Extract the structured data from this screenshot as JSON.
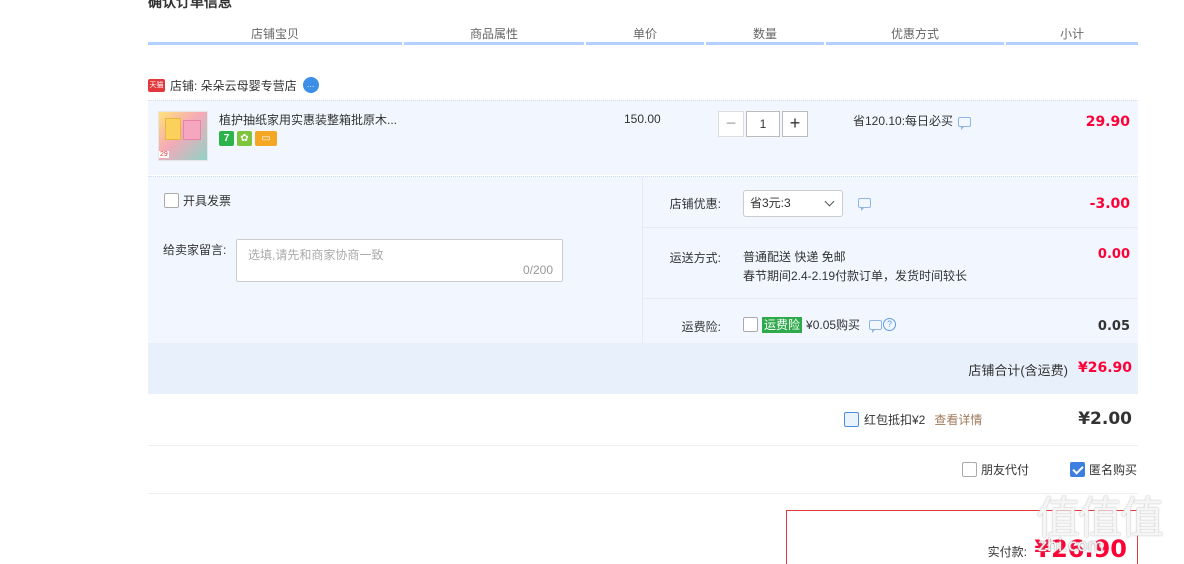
{
  "section_title": "确认订单信息",
  "columns": [
    "店铺宝贝",
    "商品属性",
    "单价",
    "数量",
    "优惠方式",
    "小计"
  ],
  "shop": {
    "logo_text": "天猫",
    "label": "店铺: 朵朵云母婴专营店"
  },
  "item": {
    "title": "植护抽纸家用实惠装整箱批原木...",
    "thumb_price": "29",
    "unit_price": "150.00",
    "quantity": "1",
    "minus_label": "−",
    "plus_label": "+",
    "discount": "省120.10:每日必买",
    "subtotal": "29.90",
    "icon_seven": "7"
  },
  "options": {
    "invoice_label": "开具发票",
    "message_label": "给卖家留言:",
    "message_placeholder": "选填,请先和商家协商一致",
    "message_count": "0/200",
    "shop_discount_label": "店铺优惠:",
    "shop_discount_value": "省3元:3",
    "shop_discount_amount": "-3.00",
    "shipping_label": "运送方式:",
    "shipping_line1": "普通配送 快递 免邮",
    "shipping_line2": "春节期间2.4-2.19付款订单，发货时间较长",
    "shipping_amount": "0.00",
    "insurance_label": "运费险:",
    "insurance_tag": "运费险",
    "insurance_text": "¥0.05购买",
    "insurance_amount": "0.05"
  },
  "shop_total": {
    "label": "店铺合计(含运费)",
    "amount": "¥26.90"
  },
  "red_packet": {
    "label": "红包抵扣¥2",
    "detail": "查看详情",
    "amount": "¥2.00"
  },
  "buy_options": {
    "friend_pay": "朋友代付",
    "anonymous": "匿名购买"
  },
  "payment": {
    "label": "实付款:",
    "amount": "¥26.90"
  },
  "watermark": {
    "chars": "值值值",
    "url": "zhi.com"
  },
  "colors": {
    "price_red": "#ff0036",
    "header_line": "#b2d1ff",
    "row_bg": "#f2f7ff",
    "insurance_green": "#2eaa4b",
    "check_blue": "#3d7fe0"
  }
}
